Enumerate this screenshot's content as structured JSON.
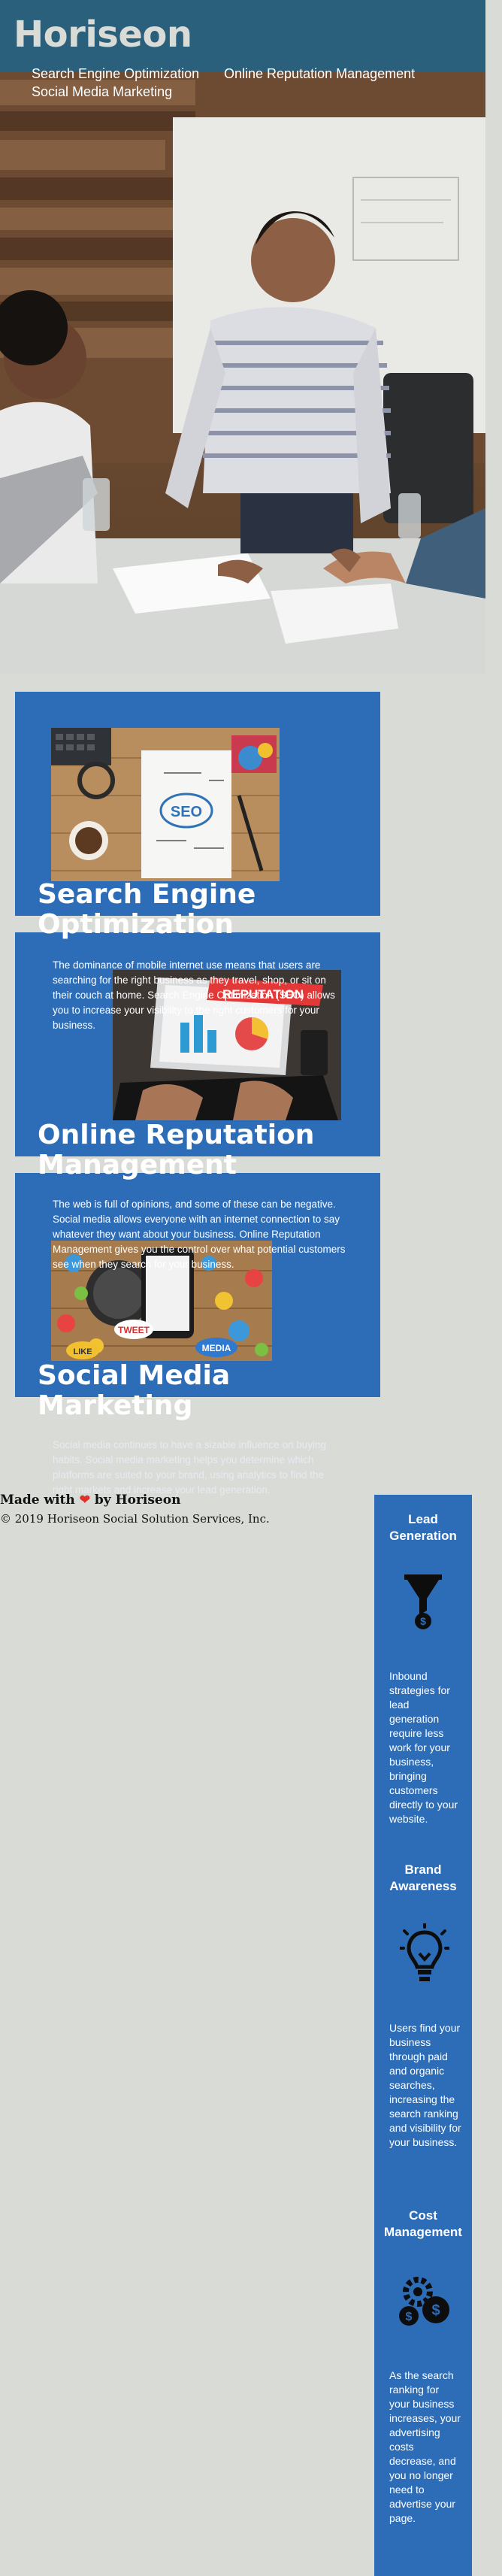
{
  "header": {
    "logo": "Horiseon",
    "nav": [
      "Search Engine Optimization",
      "Online Reputation Management",
      "Social Media Marketing"
    ]
  },
  "sections": [
    {
      "title_line1": "Search Engine",
      "title_line2": "Optimization",
      "text": "The dominance of mobile internet use means that users are searching for the right business as they travel, shop, or sit on their couch at home. Search Engine Optimization (SEO) allows you to increase your visibility to the right customers for your business."
    },
    {
      "title_line1": "Online Reputation",
      "title_line2": "Management",
      "text": "The web is full of opinions, and some of these can be negative. Social media allows everyone with an internet connection to say whatever they want about your business. Online Reputation Management gives you the control over what potential customers see when they search for your business."
    },
    {
      "title_line1": "Social Media",
      "title_line2": "Marketing",
      "text": "Social media continues to have a sizable influence on buying habits. Social media marketing helps you determine which platforms are suited to your brand, using analytics to find the right markets and increase your lead generation."
    }
  ],
  "images": {
    "seo_badge": "SEO",
    "reputation_banner": "REPUTATION",
    "tweet_bubble": "TWEET",
    "media_bubble": "MEDIA",
    "like_bubble": "LIKE"
  },
  "footer": {
    "made_prefix": "Made with",
    "made_suffix": "by Horiseon",
    "copyright": "© 2019 Horiseon Social Solution Services, Inc."
  },
  "benefits": [
    {
      "title_line1": "Lead",
      "title_line2": "Generation",
      "icon": "funnel-dollar-icon",
      "text": "Inbound strategies for lead generation require less work for your business, bringing customers directly to your website."
    },
    {
      "title_line1": "Brand",
      "title_line2": "Awareness",
      "icon": "lightbulb-icon",
      "text": "Users find your business through paid and organic searches, increasing the search ranking and visibility for your business."
    },
    {
      "title_line1": "Cost",
      "title_line2": "Management",
      "icon": "gears-dollar-icon",
      "text": "As the search ranking for your business increases, your advertising costs decrease, and you no longer need to advertise your page."
    }
  ],
  "colors": {
    "header": "#2a607c",
    "page_background": "#d9dcd6",
    "card_blue": "#2d6db8",
    "logo_text": "#d9dcd6"
  }
}
